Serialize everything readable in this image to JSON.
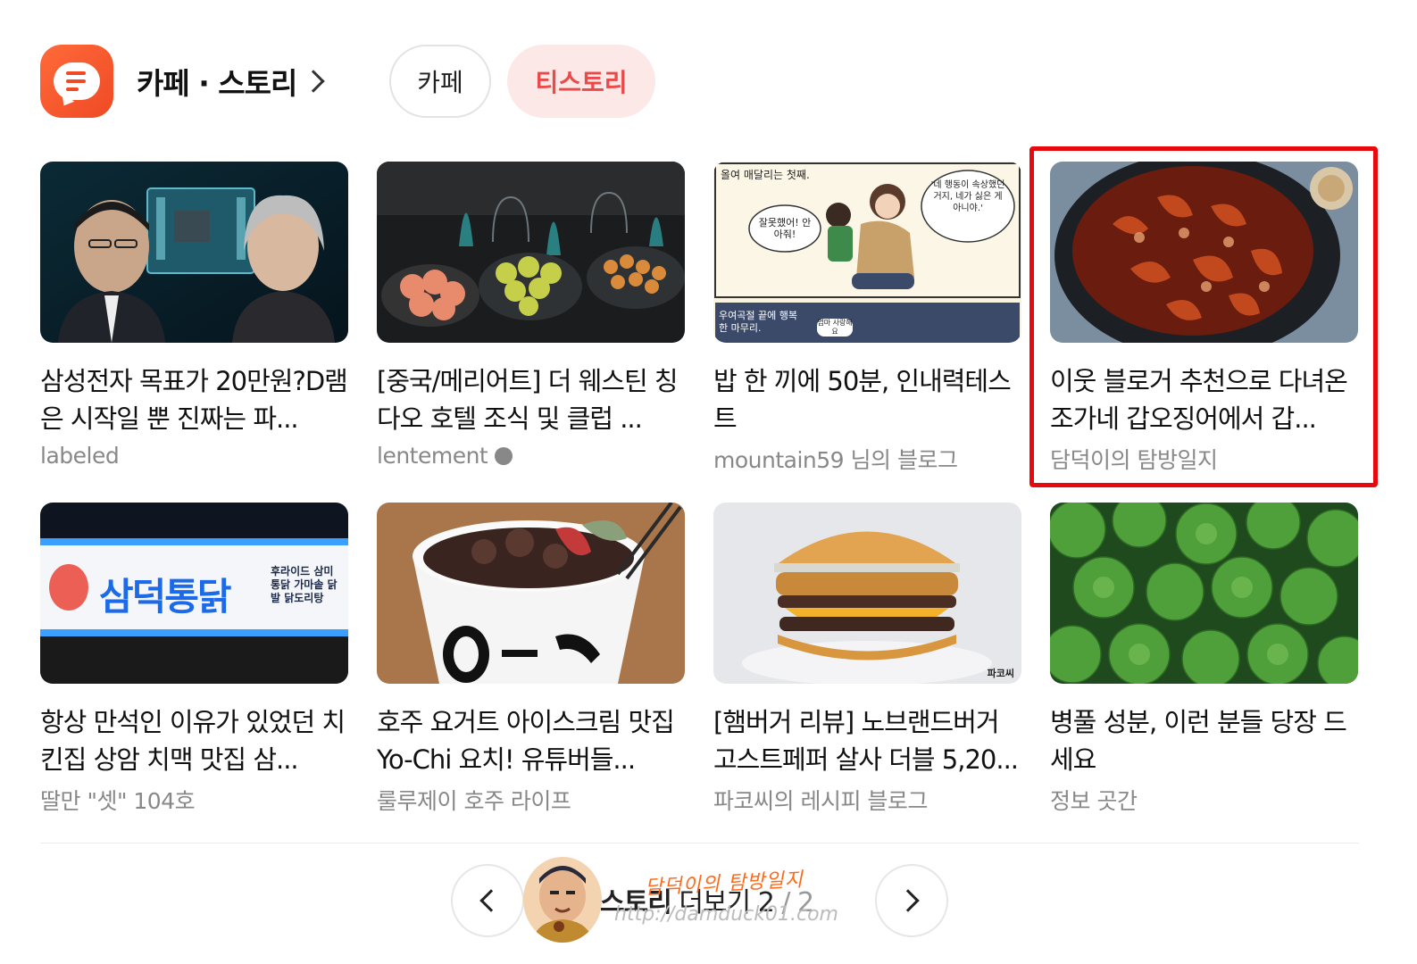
{
  "header": {
    "app_icon": "chat-bubble-icon",
    "title": "카페 · 스토리",
    "tabs": [
      {
        "label": "카페",
        "active": false
      },
      {
        "label": "티스토리",
        "active": true
      }
    ]
  },
  "colors": {
    "accent": "#ea4a4a",
    "active_tab_bg": "#fde8e8",
    "app_icon": "#ef4a24",
    "highlight_box": "#e8090c",
    "source_text": "#888888"
  },
  "cards": [
    {
      "title": "삼성전자 목표가 20만원?D램은 시작일 뿐 진짜는 파...",
      "source": "labeled"
    },
    {
      "title": "[중국/메리어트] 더 웨스틴 칭다오 호텔 조식 및 클럽 ...",
      "source": "lentement"
    },
    {
      "title": "밥 한 끼에 50분, 인내력테스트",
      "source": "mountain59 님의 블로그"
    },
    {
      "title": "이웃 블로거 추천으로 다녀온 조가네 갑오징어에서 갑...",
      "source": "담덕이의 탐방일지"
    },
    {
      "title": "항상 만석인 이유가 있었던 치킨집 상암 치맥 맛집 삼...",
      "source": "딸만 \"셋\" 104호"
    },
    {
      "title": "호주 요거트 아이스크림 맛집 Yo-Chi 요치! 유튜버들...",
      "source": "룰루제이 호주 라이프"
    },
    {
      "title": "[햄버거 리뷰] 노브랜드버거 고스트페퍼 살사 더블 5,20...",
      "source": "파코씨의 레시피 블로그"
    },
    {
      "title": "병풀 성분, 이런 분들 당장 드세요",
      "source": "정보 곳간"
    }
  ],
  "thumb_texts": {
    "comic_top": "올여 매달리는 첫째.",
    "comic_bubble_left": "잘못했어! 안아줘!",
    "comic_bubble_right": "'네 행동이 속상했던 거지, 네가 싫은 게 아니야.'",
    "comic_bottom": "우여곡절 끝에 행복한 마무리.",
    "comic_small": "엄마 사랑해요",
    "sign_main": "삼덕통닭",
    "sign_side": "후라이드 삼미통닭 가마솥 닭발 닭도리탕",
    "burger_watermark": "파코씨"
  },
  "footer": {
    "more_label": "티스토리 더보기",
    "more_label_visible": "스토리",
    "more_suffix": "더보기",
    "page_current": "2",
    "page_total": "2",
    "prev_icon": "chevron-left-icon",
    "next_icon": "chevron-right-icon"
  },
  "watermark": {
    "name": "담덕이의 탐방일지",
    "url": "http://damduck01.com"
  }
}
